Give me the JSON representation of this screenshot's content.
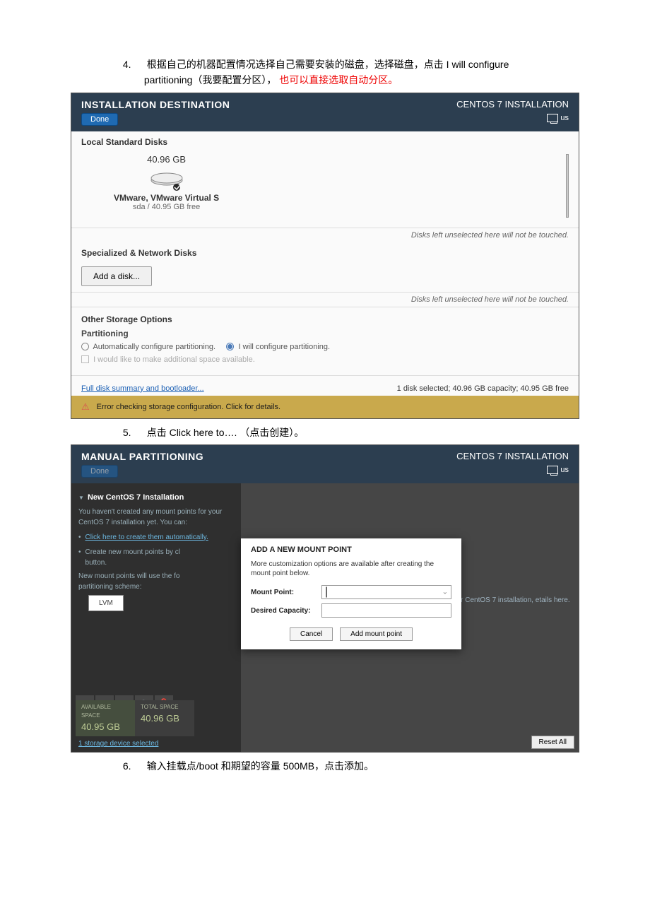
{
  "doc": {
    "step4_num": "4.",
    "step4_text_a": "根据自己的机器配置情况选择自己需要安装的磁盘，选择磁盘，点击 I will configure",
    "step4_text_b": "partitioning（我要配置分区），",
    "step4_text_red": "也可以直接选取自动分区。",
    "step5_num": "5.",
    "step5_text": "点击 Click here to….    （点击创建）。",
    "step6_num": "6.",
    "step6_text": "输入挂载点/boot 和期望的容量 500MB，点击添加。"
  },
  "s1": {
    "title": "INSTALLATION DESTINATION",
    "done": "Done",
    "installer": "CENTOS 7 INSTALLATION",
    "kb": "us",
    "local_disks": "Local Standard Disks",
    "disk_size": "40.96 GB",
    "disk_name": "VMware, VMware Virtual S",
    "disk_sub": "sda   /   40.95 GB free",
    "hint": "Disks left unselected here will not be touched.",
    "network_disks": "Specialized & Network Disks",
    "add_disk": "Add a disk...",
    "other_storage": "Other Storage Options",
    "partitioning": "Partitioning",
    "auto_conf": "Automatically configure partitioning.",
    "manual_conf": "I will configure partitioning.",
    "checkbox_label": "I would like to make additional space available.",
    "link": "Full disk summary and bootloader...",
    "status": "1 disk selected; 40.96 GB capacity; 40.95 GB free",
    "error": "Error checking storage configuration.  Click for details."
  },
  "s2": {
    "title": "MANUAL PARTITIONING",
    "done": "Done",
    "installer": "CENTOS 7 INSTALLATION",
    "kb": "us",
    "left_title": "New CentOS 7 Installation",
    "left_line1": "You haven't created any mount points for your CentOS 7 installation yet.  You can:",
    "auto_link": "Click here to create them automatically.",
    "left_line2a": "Create new mount points by cl",
    "left_line2b": "button.",
    "left_line3": "New mount points will use the fo",
    "left_line3b": "partitioning scheme:",
    "lvm": "LVM",
    "avail_label": "AVAILABLE SPACE",
    "avail_val": "40.95 GB",
    "total_label": "TOTAL SPACE",
    "total_val": "40.96 GB",
    "storage_link": "1 storage device selected",
    "right_hint": "ts for your CentOS 7 installation, etails here.",
    "reset": "Reset All",
    "modal_title": "ADD A NEW MOUNT POINT",
    "modal_desc": "More customization options are available after creating the mount point below.",
    "mount_point": "Mount Point:",
    "desired_cap": "Desired Capacity:",
    "cancel": "Cancel",
    "add": "Add mount point"
  }
}
